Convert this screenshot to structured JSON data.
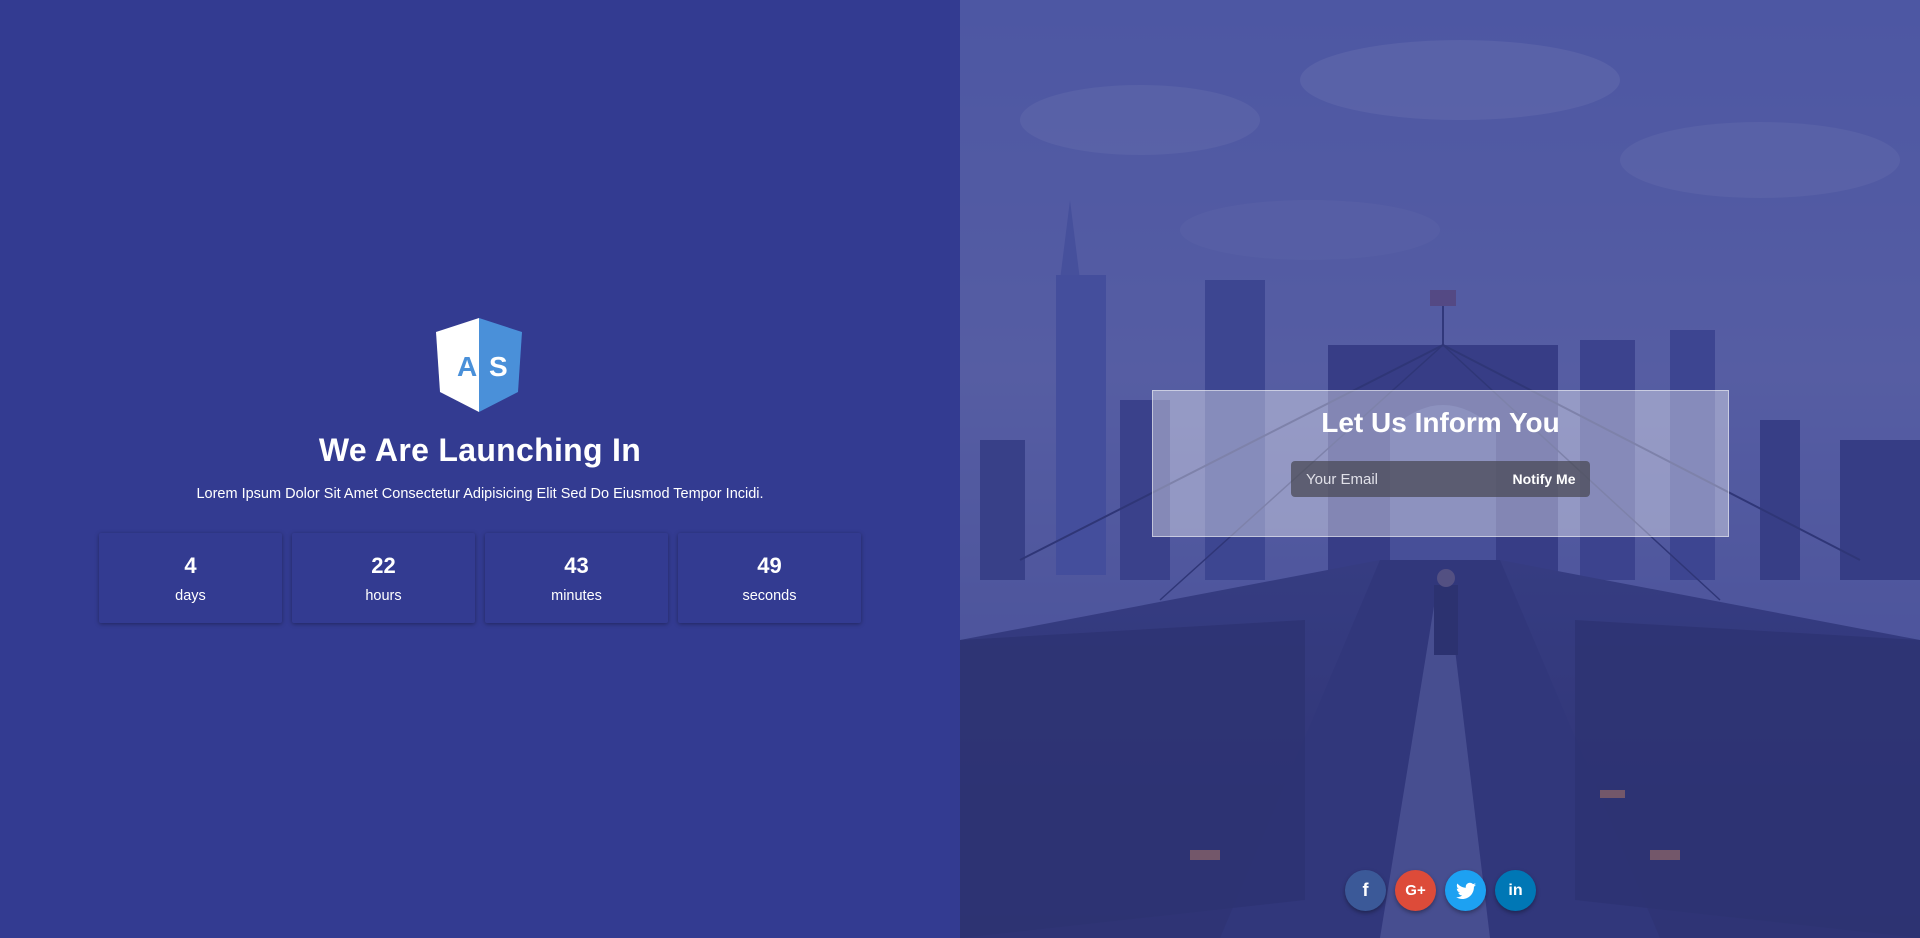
{
  "left": {
    "logo": {
      "letters": "A S",
      "icon": "shield-logo",
      "colors": {
        "light": "#ffffff",
        "dark": "#4a90d9"
      }
    },
    "headline": "We Are Launching In",
    "subline": "Lorem Ipsum Dolor Sit Amet Consectetur Adipisicing Elit Sed Do Eiusmod Tempor Incidi.",
    "countdown": [
      {
        "value": "4",
        "unit": "days"
      },
      {
        "value": "22",
        "unit": "hours"
      },
      {
        "value": "43",
        "unit": "minutes"
      },
      {
        "value": "49",
        "unit": "seconds"
      }
    ]
  },
  "right": {
    "background": "city-bridge-photo",
    "inform": {
      "title": "Let Us Inform You",
      "email_placeholder": "Your Email",
      "button_label": "Notify Me"
    },
    "socials": [
      {
        "name": "facebook",
        "glyph": "f",
        "color": "#3b5998"
      },
      {
        "name": "google-plus",
        "glyph": "G+",
        "color": "#dd4b39"
      },
      {
        "name": "twitter",
        "glyph": "t",
        "color": "#1da1f2"
      },
      {
        "name": "linkedin",
        "glyph": "in",
        "color": "#0077b5"
      }
    ]
  },
  "colors": {
    "primary": "#333b91"
  }
}
